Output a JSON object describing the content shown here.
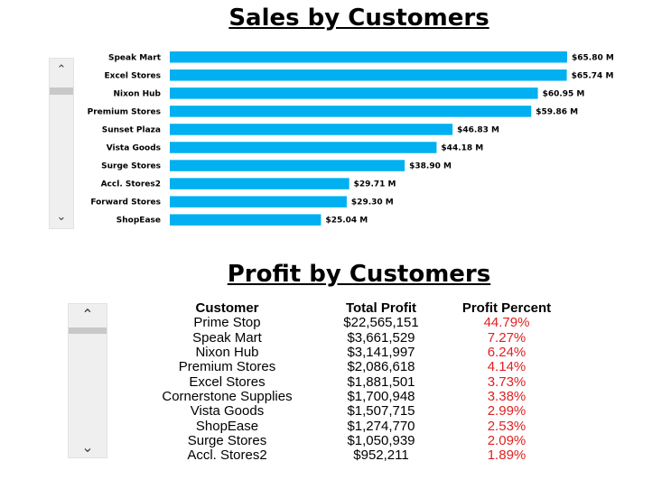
{
  "sales": {
    "title": "Sales by Customers"
  },
  "profit": {
    "title": "Profit by Customers",
    "headers": [
      "Customer",
      "Total Profit",
      "Profit Percent"
    ],
    "rows": [
      {
        "customer": "Prime Stop",
        "total_profit": "$22,565,151",
        "percent": "44.79%"
      },
      {
        "customer": "Speak Mart",
        "total_profit": "$3,661,529",
        "percent": "7.27%"
      },
      {
        "customer": "Nixon Hub",
        "total_profit": "$3,141,997",
        "percent": "6.24%"
      },
      {
        "customer": "Premium Stores",
        "total_profit": "$2,086,618",
        "percent": "4.14%"
      },
      {
        "customer": "Excel Stores",
        "total_profit": "$1,881,501",
        "percent": "3.73%"
      },
      {
        "customer": "Cornerstone Supplies",
        "total_profit": "$1,700,948",
        "percent": "3.38%"
      },
      {
        "customer": "Vista Goods",
        "total_profit": "$1,507,715",
        "percent": "2.99%"
      },
      {
        "customer": "ShopEase",
        "total_profit": "$1,274,770",
        "percent": "2.53%"
      },
      {
        "customer": "Surge Stores",
        "total_profit": "$1,050,939",
        "percent": "2.09%"
      },
      {
        "customer": "Accl. Stores2",
        "total_profit": "$952,211",
        "percent": "1.89%"
      }
    ],
    "percent_color": "#e02020"
  },
  "scroll": {
    "up_icon": "chevron-up-icon",
    "down_icon": "chevron-down-icon"
  },
  "chart_data": {
    "type": "bar",
    "orientation": "horizontal",
    "title": "Sales by Customers",
    "categories": [
      "Speak Mart",
      "Excel Stores",
      "Nixon Hub",
      "Premium Stores",
      "Sunset Plaza",
      "Vista Goods",
      "Surge Stores",
      "Accl. Stores2",
      "Forward Stores",
      "ShopEase"
    ],
    "values": [
      65.8,
      65.74,
      60.95,
      59.86,
      46.83,
      44.18,
      38.9,
      29.71,
      29.3,
      25.04
    ],
    "value_labels": [
      "$65.80 M",
      "$65.74 M",
      "$60.95 M",
      "$59.86 M",
      "$46.83 M",
      "$44.18 M",
      "$38.90 M",
      "$29.71 M",
      "$29.30 M",
      "$25.04 M"
    ],
    "bar_color": "#00b0f0",
    "grid": false,
    "legend": "none"
  }
}
